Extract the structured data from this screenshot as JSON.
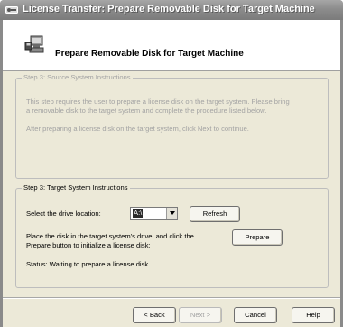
{
  "window": {
    "title": "License Transfer: Prepare Removable Disk for Target Machine"
  },
  "header": {
    "title": "Prepare Removable Disk for Target Machine"
  },
  "source_group": {
    "legend": "Step 3: Source System Instructions",
    "line1": "This step requires the user to prepare a license disk on the target system.  Please bring",
    "line2": "a removable disk to the target system and complete the procedure listed below.",
    "line3": "After preparing a license disk on the target system, click Next to continue."
  },
  "target_group": {
    "legend": "Step 3: Target System Instructions",
    "drive_label": "Select the drive location:",
    "drive_value": "A:\\",
    "refresh_label": "Refresh",
    "place_line1": "Place the disk in the target system's drive, and click the",
    "place_line2": "Prepare button to initialize a license disk:",
    "prepare_label": "Prepare",
    "status": "Status: Waiting to prepare a license disk."
  },
  "footer": {
    "back_label": "< Back",
    "next_label": "Next >",
    "cancel_label": "Cancel",
    "help_label": "Help"
  },
  "icons": {
    "app": "key-icon",
    "header": "computer-disk-icon"
  }
}
